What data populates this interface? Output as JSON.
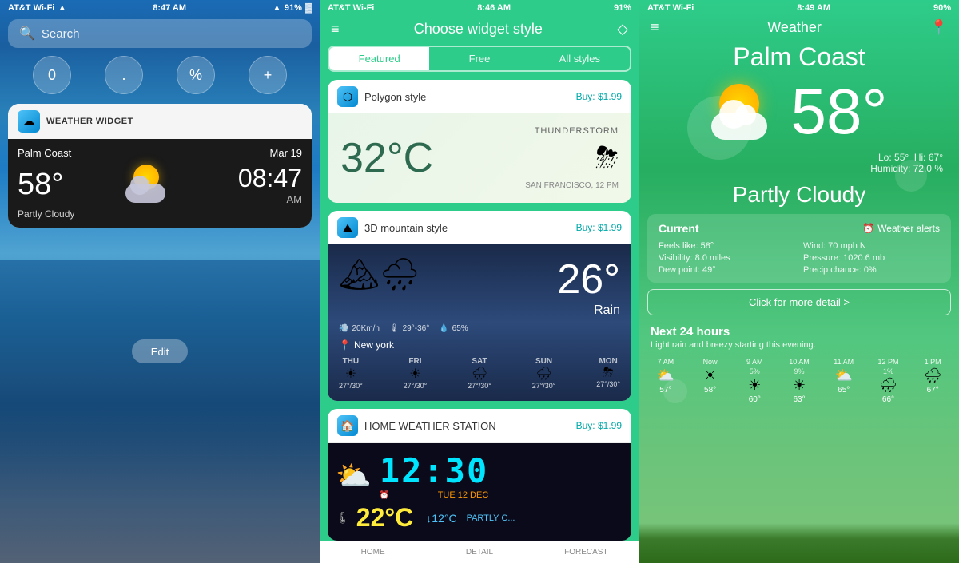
{
  "panel1": {
    "status_bar": {
      "carrier": "AT&T Wi-Fi",
      "time": "8:47 AM",
      "battery": "91%"
    },
    "search_placeholder": "Search",
    "keypad": [
      "0",
      ".",
      "%",
      "+"
    ],
    "widget": {
      "title": "WEATHER WIDGET",
      "location": "Palm Coast",
      "date": "Mar 19",
      "temp": "58°",
      "time_display": "08:47",
      "ampm": "AM",
      "condition": "Partly Cloudy"
    },
    "edit_label": "Edit"
  },
  "panel2": {
    "status_bar": {
      "carrier": "AT&T Wi-Fi",
      "time": "8:46 AM",
      "battery": "91%"
    },
    "header_title": "Choose widget style",
    "tabs": [
      {
        "label": "Featured",
        "active": true
      },
      {
        "label": "Free",
        "active": false
      },
      {
        "label": "All styles",
        "active": false
      }
    ],
    "cards": [
      {
        "name": "Polygon style",
        "price": "Buy: $1.99",
        "temp": "32°C",
        "condition": "THUNDERSTORM",
        "location": "SAN FRANCISCO, 12 PM"
      },
      {
        "name": "3D mountain style",
        "price": "Buy: $1.99",
        "temp": "26°",
        "condition": "Rain",
        "wind": "20Km/h",
        "temp_range": "29°-36°",
        "humidity": "65%",
        "location": "New york",
        "forecast": [
          {
            "day": "THU",
            "temps": "27°/30°"
          },
          {
            "day": "FRI",
            "temps": "27°/30°"
          },
          {
            "day": "SAT",
            "temps": "27°/30°"
          },
          {
            "day": "SUN",
            "temps": "27°/30°"
          },
          {
            "day": "MON",
            "temps": "27°/30°"
          }
        ]
      },
      {
        "name": "HOME WEATHER STATION",
        "price": "Buy: $1.99",
        "time_display": "12:30",
        "date": "TUE 12 DEC",
        "temp": "22°C",
        "drop_temp": "↓12°C",
        "condition": "PARTLY C..."
      }
    ],
    "bottom_tabs": [
      "HOME",
      "DETAIL",
      "FORECAST"
    ]
  },
  "panel3": {
    "status_bar": {
      "carrier": "AT&T Wi-Fi",
      "time": "8:49 AM",
      "battery": "90%"
    },
    "header_title": "Weather",
    "city": "Palm Coast",
    "temp": "58°",
    "lo": "55°",
    "hi": "67°",
    "humidity": "72.0",
    "condition": "Partly Cloudy",
    "current_label": "Current",
    "alerts_label": "Weather alerts",
    "info": {
      "feels_like": "Feels like: 58°",
      "wind": "Wind: 70 mph N",
      "visibility": "Visibility: 8.0 miles",
      "pressure": "Pressure: 1020.6 mb",
      "dew_point": "Dew point: 49°",
      "precip": "Precip chance: 0%"
    },
    "detail_btn": "Click for more detail >",
    "next24_label": "Next 24 hours",
    "forecast_desc": "Light rain and breezy starting this evening.",
    "hourly": [
      {
        "time": "7 AM",
        "pct": "",
        "temp": "57°"
      },
      {
        "time": "Now",
        "pct": "",
        "temp": "58°"
      },
      {
        "time": "9 AM",
        "pct": "5%",
        "temp": "60°"
      },
      {
        "time": "10 AM",
        "pct": "9%",
        "temp": "63°"
      },
      {
        "time": "11 AM",
        "pct": "",
        "temp": "65°"
      },
      {
        "time": "12 PM",
        "pct": "1%",
        "temp": "66°"
      },
      {
        "time": "1 PM",
        "pct": "",
        "temp": "67°"
      }
    ]
  }
}
